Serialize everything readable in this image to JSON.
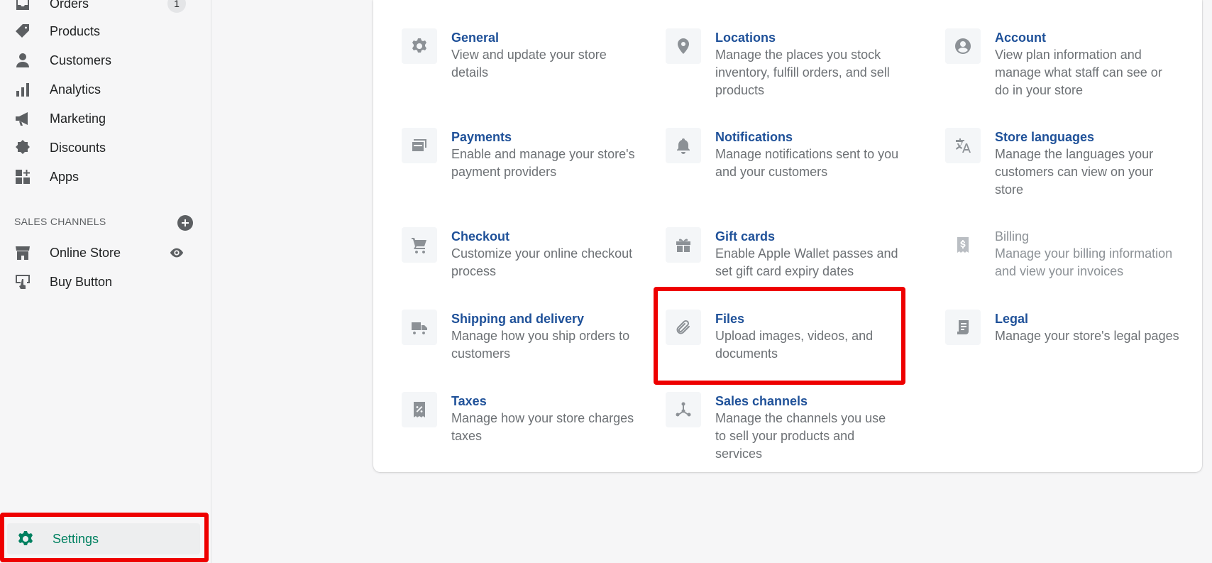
{
  "sidebar": {
    "items": [
      {
        "label": "Orders",
        "icon": "orders-icon",
        "badge": "1"
      },
      {
        "label": "Products",
        "icon": "tag-icon"
      },
      {
        "label": "Customers",
        "icon": "person-icon"
      },
      {
        "label": "Analytics",
        "icon": "bar-chart-icon"
      },
      {
        "label": "Marketing",
        "icon": "megaphone-icon"
      },
      {
        "label": "Discounts",
        "icon": "discount-icon"
      },
      {
        "label": "Apps",
        "icon": "apps-icon"
      }
    ],
    "sales_channels_heading": "SALES CHANNELS",
    "channels": [
      {
        "label": "Online Store",
        "icon": "store-icon"
      },
      {
        "label": "Buy Button",
        "icon": "buy-button-icon"
      }
    ],
    "settings_label": "Settings"
  },
  "settings": {
    "tiles": [
      {
        "title": "General",
        "desc": "View and update your store details",
        "icon": "gear-icon"
      },
      {
        "title": "Locations",
        "desc": "Manage the places you stock inventory, fulfill orders, and sell products",
        "icon": "location-pin-icon"
      },
      {
        "title": "Account",
        "desc": "View plan information and manage what staff can see or do in your store",
        "icon": "account-icon"
      },
      {
        "title": "Payments",
        "desc": "Enable and manage your store's payment providers",
        "icon": "payments-icon"
      },
      {
        "title": "Notifications",
        "desc": "Manage notifications sent to you and your customers",
        "icon": "bell-icon"
      },
      {
        "title": "Store languages",
        "desc": "Manage the languages your customers can view on your store",
        "icon": "translate-icon"
      },
      {
        "title": "Checkout",
        "desc": "Customize your online checkout process",
        "icon": "cart-icon"
      },
      {
        "title": "Gift cards",
        "desc": "Enable Apple Wallet passes and set gift card expiry dates",
        "icon": "gift-icon"
      },
      {
        "title": "Billing",
        "desc": "Manage your billing information and view your invoices",
        "icon": "billing-icon"
      },
      {
        "title": "Shipping and delivery",
        "desc": "Manage how you ship orders to customers",
        "icon": "truck-icon"
      },
      {
        "title": "Files",
        "desc": "Upload images, videos, and documents",
        "icon": "paperclip-icon"
      },
      {
        "title": "Legal",
        "desc": "Manage your store's legal pages",
        "icon": "legal-icon"
      },
      {
        "title": "Taxes",
        "desc": "Manage how your store charges taxes",
        "icon": "taxes-icon"
      },
      {
        "title": "Sales channels",
        "desc": "Manage the channels you use to sell your products and services",
        "icon": "sales-channels-icon"
      }
    ]
  },
  "colors": {
    "accent_green": "#008060",
    "link_blue": "#1f5199",
    "highlight_red": "#ee0000"
  }
}
